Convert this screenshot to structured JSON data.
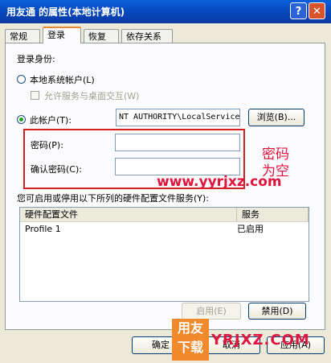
{
  "window": {
    "title": "用友通 的属性(本地计算机)",
    "help_glyph": "?",
    "close_glyph": "✕"
  },
  "tabs": [
    {
      "label": "常规"
    },
    {
      "label": "登录"
    },
    {
      "label": "恢复"
    },
    {
      "label": "依存关系"
    }
  ],
  "login": {
    "section_label": "登录身份:",
    "local_system": "本地系统帐户(L)",
    "allow_desktop": "允许服务与桌面交互(W)",
    "this_account": "此帐户(T):",
    "account_value": "NT AUTHORITY\\LocalService",
    "browse": "浏览(B)...",
    "password": "密码(P):",
    "confirm": "确认密码(C):",
    "password_value": "",
    "confirm_value": ""
  },
  "annotation": {
    "line1": "密码",
    "line2": "为空",
    "watermark": "www.yyrjxz.com",
    "colors": {
      "annotation": "#e0143c",
      "box": "#d42020"
    }
  },
  "profiles": {
    "label": "您可启用或停用以下所列的硬件配置文件服务(Y):",
    "columns": [
      "硬件配置文件",
      "服务"
    ],
    "rows": [
      {
        "profile": "Profile 1",
        "service": "已启用"
      }
    ],
    "enable": "启用(E)",
    "disable": "禁用(D)"
  },
  "footer": {
    "ok": "确定",
    "cancel": "取消",
    "apply": "应用(A)"
  },
  "watermark_logo": {
    "line1": "用友",
    "line2": "下载",
    "text": "YRJXZ.COM"
  }
}
